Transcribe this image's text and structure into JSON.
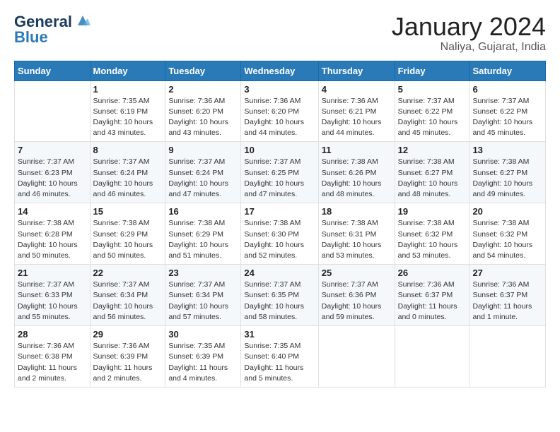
{
  "header": {
    "logo_general": "General",
    "logo_blue": "Blue",
    "month_title": "January 2024",
    "location": "Naliya, Gujarat, India"
  },
  "days_of_week": [
    "Sunday",
    "Monday",
    "Tuesday",
    "Wednesday",
    "Thursday",
    "Friday",
    "Saturday"
  ],
  "weeks": [
    [
      {
        "num": "",
        "sunrise": "",
        "sunset": "",
        "daylight": ""
      },
      {
        "num": "1",
        "sunrise": "Sunrise: 7:35 AM",
        "sunset": "Sunset: 6:19 PM",
        "daylight": "Daylight: 10 hours and 43 minutes."
      },
      {
        "num": "2",
        "sunrise": "Sunrise: 7:36 AM",
        "sunset": "Sunset: 6:20 PM",
        "daylight": "Daylight: 10 hours and 43 minutes."
      },
      {
        "num": "3",
        "sunrise": "Sunrise: 7:36 AM",
        "sunset": "Sunset: 6:20 PM",
        "daylight": "Daylight: 10 hours and 44 minutes."
      },
      {
        "num": "4",
        "sunrise": "Sunrise: 7:36 AM",
        "sunset": "Sunset: 6:21 PM",
        "daylight": "Daylight: 10 hours and 44 minutes."
      },
      {
        "num": "5",
        "sunrise": "Sunrise: 7:37 AM",
        "sunset": "Sunset: 6:22 PM",
        "daylight": "Daylight: 10 hours and 45 minutes."
      },
      {
        "num": "6",
        "sunrise": "Sunrise: 7:37 AM",
        "sunset": "Sunset: 6:22 PM",
        "daylight": "Daylight: 10 hours and 45 minutes."
      }
    ],
    [
      {
        "num": "7",
        "sunrise": "Sunrise: 7:37 AM",
        "sunset": "Sunset: 6:23 PM",
        "daylight": "Daylight: 10 hours and 46 minutes."
      },
      {
        "num": "8",
        "sunrise": "Sunrise: 7:37 AM",
        "sunset": "Sunset: 6:24 PM",
        "daylight": "Daylight: 10 hours and 46 minutes."
      },
      {
        "num": "9",
        "sunrise": "Sunrise: 7:37 AM",
        "sunset": "Sunset: 6:24 PM",
        "daylight": "Daylight: 10 hours and 47 minutes."
      },
      {
        "num": "10",
        "sunrise": "Sunrise: 7:37 AM",
        "sunset": "Sunset: 6:25 PM",
        "daylight": "Daylight: 10 hours and 47 minutes."
      },
      {
        "num": "11",
        "sunrise": "Sunrise: 7:38 AM",
        "sunset": "Sunset: 6:26 PM",
        "daylight": "Daylight: 10 hours and 48 minutes."
      },
      {
        "num": "12",
        "sunrise": "Sunrise: 7:38 AM",
        "sunset": "Sunset: 6:27 PM",
        "daylight": "Daylight: 10 hours and 48 minutes."
      },
      {
        "num": "13",
        "sunrise": "Sunrise: 7:38 AM",
        "sunset": "Sunset: 6:27 PM",
        "daylight": "Daylight: 10 hours and 49 minutes."
      }
    ],
    [
      {
        "num": "14",
        "sunrise": "Sunrise: 7:38 AM",
        "sunset": "Sunset: 6:28 PM",
        "daylight": "Daylight: 10 hours and 50 minutes."
      },
      {
        "num": "15",
        "sunrise": "Sunrise: 7:38 AM",
        "sunset": "Sunset: 6:29 PM",
        "daylight": "Daylight: 10 hours and 50 minutes."
      },
      {
        "num": "16",
        "sunrise": "Sunrise: 7:38 AM",
        "sunset": "Sunset: 6:29 PM",
        "daylight": "Daylight: 10 hours and 51 minutes."
      },
      {
        "num": "17",
        "sunrise": "Sunrise: 7:38 AM",
        "sunset": "Sunset: 6:30 PM",
        "daylight": "Daylight: 10 hours and 52 minutes."
      },
      {
        "num": "18",
        "sunrise": "Sunrise: 7:38 AM",
        "sunset": "Sunset: 6:31 PM",
        "daylight": "Daylight: 10 hours and 53 minutes."
      },
      {
        "num": "19",
        "sunrise": "Sunrise: 7:38 AM",
        "sunset": "Sunset: 6:32 PM",
        "daylight": "Daylight: 10 hours and 53 minutes."
      },
      {
        "num": "20",
        "sunrise": "Sunrise: 7:38 AM",
        "sunset": "Sunset: 6:32 PM",
        "daylight": "Daylight: 10 hours and 54 minutes."
      }
    ],
    [
      {
        "num": "21",
        "sunrise": "Sunrise: 7:37 AM",
        "sunset": "Sunset: 6:33 PM",
        "daylight": "Daylight: 10 hours and 55 minutes."
      },
      {
        "num": "22",
        "sunrise": "Sunrise: 7:37 AM",
        "sunset": "Sunset: 6:34 PM",
        "daylight": "Daylight: 10 hours and 56 minutes."
      },
      {
        "num": "23",
        "sunrise": "Sunrise: 7:37 AM",
        "sunset": "Sunset: 6:34 PM",
        "daylight": "Daylight: 10 hours and 57 minutes."
      },
      {
        "num": "24",
        "sunrise": "Sunrise: 7:37 AM",
        "sunset": "Sunset: 6:35 PM",
        "daylight": "Daylight: 10 hours and 58 minutes."
      },
      {
        "num": "25",
        "sunrise": "Sunrise: 7:37 AM",
        "sunset": "Sunset: 6:36 PM",
        "daylight": "Daylight: 10 hours and 59 minutes."
      },
      {
        "num": "26",
        "sunrise": "Sunrise: 7:36 AM",
        "sunset": "Sunset: 6:37 PM",
        "daylight": "Daylight: 11 hours and 0 minutes."
      },
      {
        "num": "27",
        "sunrise": "Sunrise: 7:36 AM",
        "sunset": "Sunset: 6:37 PM",
        "daylight": "Daylight: 11 hours and 1 minute."
      }
    ],
    [
      {
        "num": "28",
        "sunrise": "Sunrise: 7:36 AM",
        "sunset": "Sunset: 6:38 PM",
        "daylight": "Daylight: 11 hours and 2 minutes."
      },
      {
        "num": "29",
        "sunrise": "Sunrise: 7:36 AM",
        "sunset": "Sunset: 6:39 PM",
        "daylight": "Daylight: 11 hours and 2 minutes."
      },
      {
        "num": "30",
        "sunrise": "Sunrise: 7:35 AM",
        "sunset": "Sunset: 6:39 PM",
        "daylight": "Daylight: 11 hours and 4 minutes."
      },
      {
        "num": "31",
        "sunrise": "Sunrise: 7:35 AM",
        "sunset": "Sunset: 6:40 PM",
        "daylight": "Daylight: 11 hours and 5 minutes."
      },
      {
        "num": "",
        "sunrise": "",
        "sunset": "",
        "daylight": ""
      },
      {
        "num": "",
        "sunrise": "",
        "sunset": "",
        "daylight": ""
      },
      {
        "num": "",
        "sunrise": "",
        "sunset": "",
        "daylight": ""
      }
    ]
  ]
}
